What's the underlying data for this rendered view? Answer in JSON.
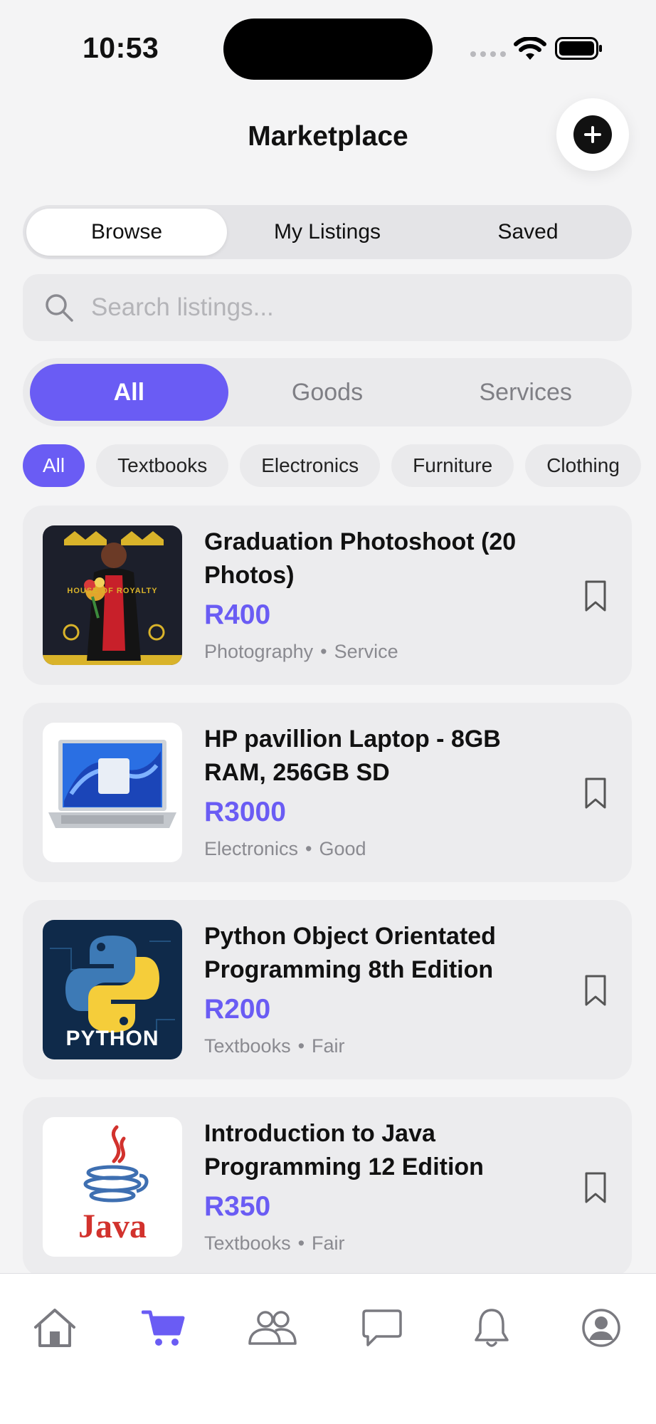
{
  "status_bar": {
    "time": "10:53"
  },
  "header": {
    "title": "Marketplace"
  },
  "segment_tabs": [
    {
      "label": "Browse",
      "active": true
    },
    {
      "label": "My Listings",
      "active": false
    },
    {
      "label": "Saved",
      "active": false
    }
  ],
  "search": {
    "placeholder": "Search listings..."
  },
  "type_tabs": [
    {
      "label": "All",
      "active": true
    },
    {
      "label": "Goods",
      "active": false
    },
    {
      "label": "Services",
      "active": false
    }
  ],
  "categories": [
    {
      "label": "All",
      "active": true
    },
    {
      "label": "Textbooks",
      "active": false
    },
    {
      "label": "Electronics",
      "active": false
    },
    {
      "label": "Furniture",
      "active": false
    },
    {
      "label": "Clothing",
      "active": false
    }
  ],
  "listings": [
    {
      "title": "Graduation Photoshoot (20 Photos)",
      "price": "R400",
      "category": "Photography",
      "condition": "Service",
      "thumbnail": "graduation-photo",
      "banner_text": "HOUSE OF ROYALTY"
    },
    {
      "title": "HP pavillion Laptop - 8GB RAM, 256GB SD",
      "price": "R3000",
      "category": "Electronics",
      "condition": "Good",
      "thumbnail": "laptop-photo"
    },
    {
      "title": "Python Object Orientated Programming 8th Edition",
      "price": "R200",
      "category": "Textbooks",
      "condition": "Fair",
      "thumbnail": "python-logo",
      "logo_text": "PYTHON"
    },
    {
      "title": "Introduction to Java Programming 12 Edition",
      "price": "R350",
      "category": "Textbooks",
      "condition": "Fair",
      "thumbnail": "java-logo",
      "logo_text": "Java"
    }
  ],
  "meta_separator": "•",
  "tab_bar": [
    {
      "icon": "home-icon",
      "active": false
    },
    {
      "icon": "cart-icon",
      "active": true
    },
    {
      "icon": "people-icon",
      "active": false
    },
    {
      "icon": "chat-icon",
      "active": false
    },
    {
      "icon": "bell-icon",
      "active": false
    },
    {
      "icon": "profile-icon",
      "active": false
    }
  ],
  "colors": {
    "accent": "#6a5cf4",
    "background": "#f4f4f5",
    "card": "#ececee",
    "inactive_icon": "#7a7a80"
  }
}
